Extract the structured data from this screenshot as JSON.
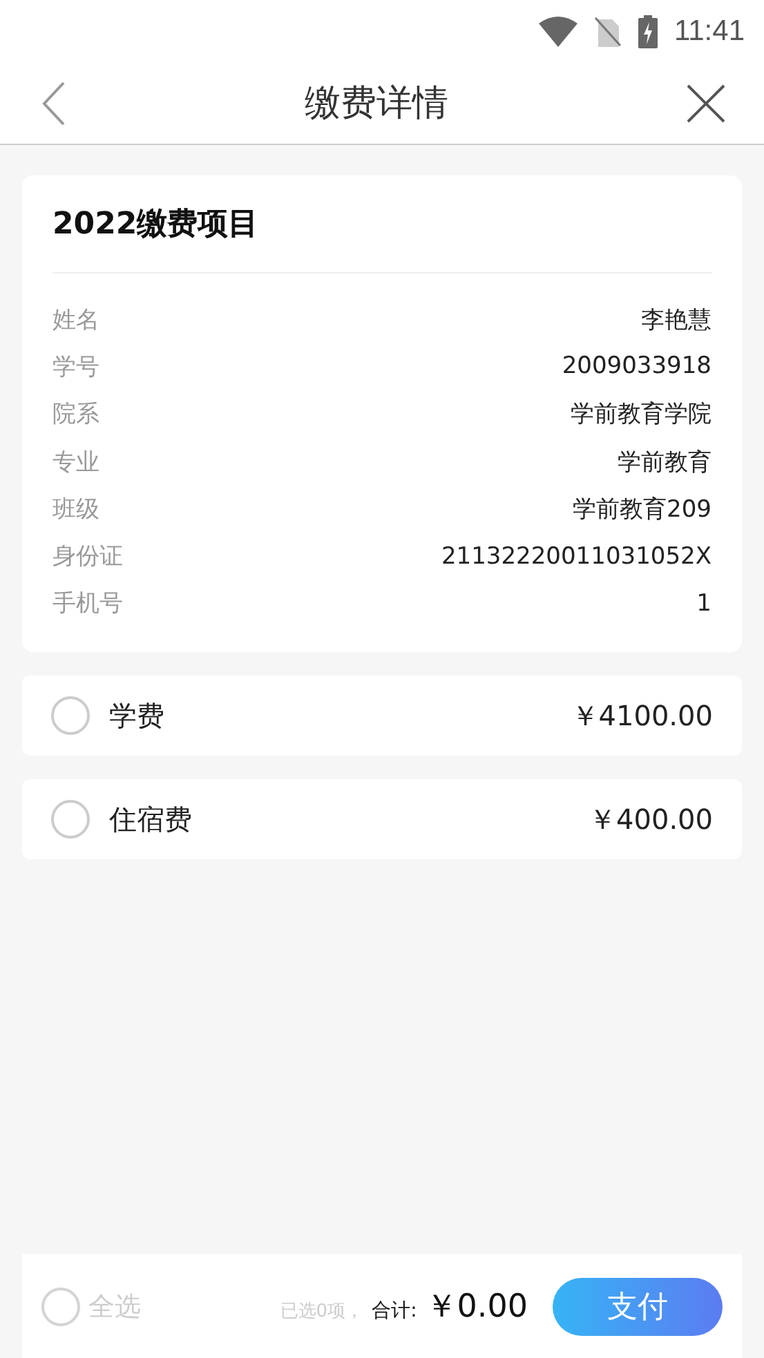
{
  "status_bar": {
    "time": "11:41"
  },
  "header": {
    "title": "缴费详情"
  },
  "info_card": {
    "title": "2022缴费项目",
    "rows": [
      {
        "label": "姓名",
        "value": "李艳慧"
      },
      {
        "label": "学号",
        "value": "2009033918"
      },
      {
        "label": "院系",
        "value": "学前教育学院"
      },
      {
        "label": "专业",
        "value": "学前教育"
      },
      {
        "label": "班级",
        "value": "学前教育209"
      },
      {
        "label": "身份证",
        "value": "21132220011031052X"
      },
      {
        "label": "手机号",
        "value": "1"
      }
    ]
  },
  "fees": [
    {
      "name": "学费",
      "amount": "￥4100.00",
      "checked": false
    },
    {
      "name": "住宿费",
      "amount": "￥400.00",
      "checked": false
    }
  ],
  "footer": {
    "select_all": {
      "label": "全选",
      "checked": false
    },
    "selected_count": "已选0项，",
    "total_label": "合计:",
    "total": "￥0.00",
    "pay_button": "支付"
  }
}
